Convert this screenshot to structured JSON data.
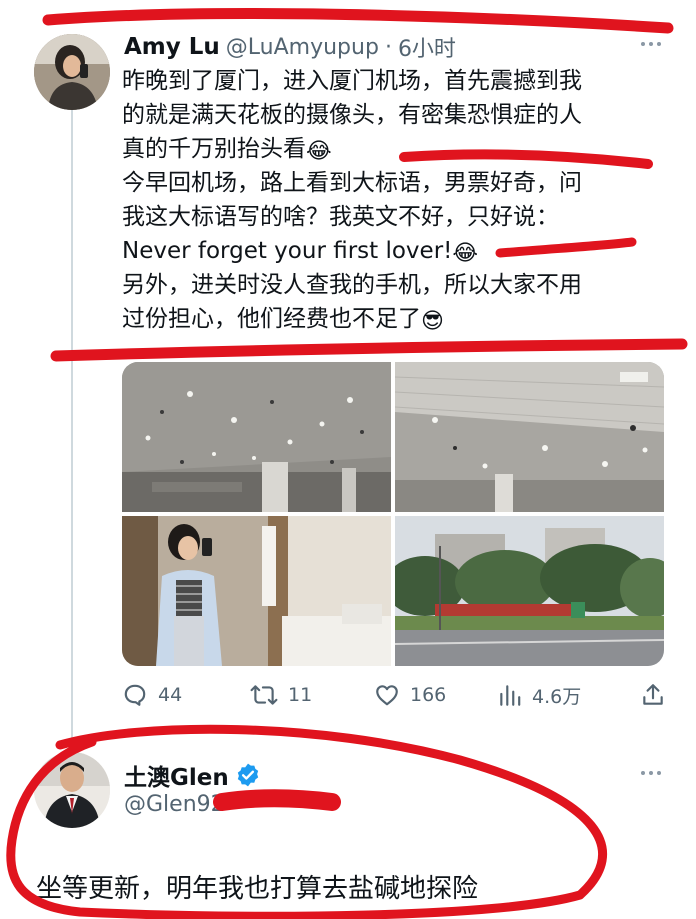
{
  "tweet1": {
    "author_name": "Amy Lu",
    "handle": "@LuAmyupup",
    "separator": "·",
    "time": "6小时",
    "text_lines": [
      "昨晚到了厦门，进入厦门机场，首先震撼到我",
      "的就是满天花板的摄像头，有密集恐惧症的人",
      "真的千万别抬头看",
      "今早回机场，路上看到大标语，男票好奇，问",
      "我这大标语写的啥？我英文不好，只好说：",
      "Never forget your first lover!",
      "另外，进关时没人查我的手机，所以大家不用",
      "过份担心，他们经费也不足了"
    ],
    "emoji_laugh": "😂",
    "emoji_cool": "😎",
    "media": [
      {
        "alt": "airport ceiling with cameras"
      },
      {
        "alt": "airport ceiling with cameras"
      },
      {
        "alt": "selfie in restroom mirror"
      },
      {
        "alt": "roadside banners and trees"
      }
    ],
    "actions": {
      "replies": "44",
      "retweets": "11",
      "likes": "166",
      "views": "4.6万"
    }
  },
  "tweet2": {
    "author_name": "土澳Glen",
    "handle": "@Glen92",
    "text": "坐等更新，明年我也打算去盐碱地探险"
  },
  "icons": {
    "more": "more-icon",
    "reply": "reply-icon",
    "retweet": "retweet-icon",
    "like": "heart-icon",
    "views": "views-icon",
    "share": "share-icon",
    "verified": "verified-badge-icon"
  },
  "colors": {
    "annotation_red": "#e0141e",
    "text_primary": "#0f1419",
    "text_secondary": "#536471",
    "verified_blue": "#1d9bf0"
  }
}
